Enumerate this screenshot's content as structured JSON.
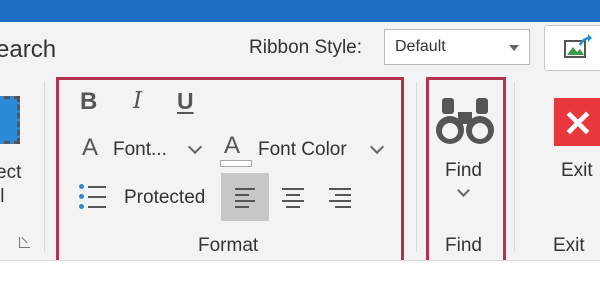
{
  "header": {
    "search_partial_label": "earch",
    "ribbon_style_label": "Ribbon Style:",
    "ribbon_style_value": "Default"
  },
  "select_all": {
    "line1": "ect",
    "line2": "ll"
  },
  "format_group": {
    "label": "Format",
    "bold_glyph": "B",
    "italic_glyph": "I",
    "underline_glyph": "U",
    "font_glyph": "A",
    "font_label": "Font...",
    "font_color_glyph": "A",
    "font_color_label": "Font Color",
    "protected_label": "Protected",
    "active_alignment": "left"
  },
  "find_group": {
    "button_label": "Find",
    "group_label": "Find"
  },
  "exit_group": {
    "button_label": "Exit",
    "group_label": "Exit",
    "icon_glyph": "✕"
  },
  "colors": {
    "titlebar": "#1e6fc4",
    "highlight": "#b5324f",
    "exit_red": "#e8383d",
    "bullet_blue": "#2b8bd6"
  }
}
